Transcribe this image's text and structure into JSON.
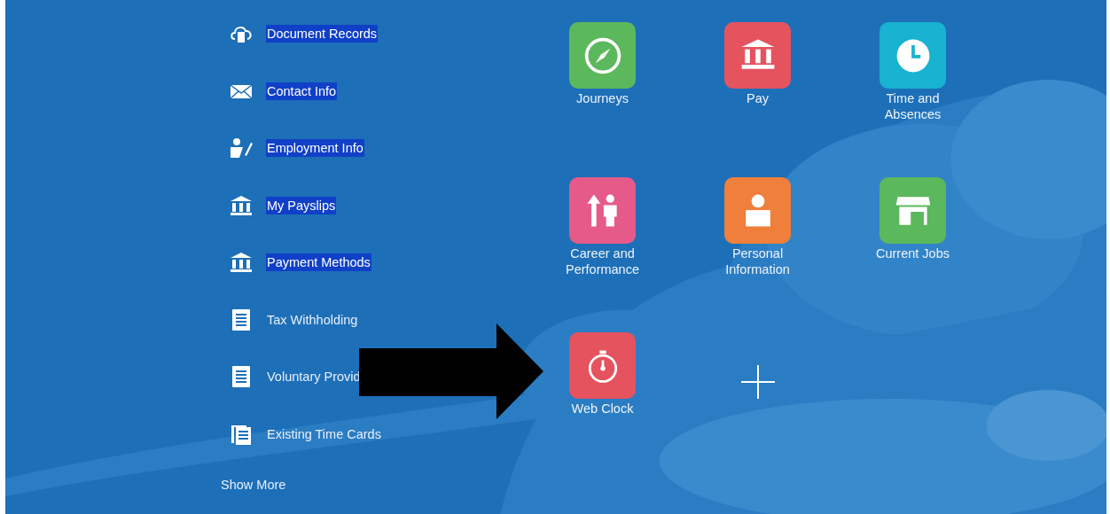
{
  "quick_actions": [
    {
      "label": "Document Records",
      "kind": "cloud-document",
      "highlighted": true
    },
    {
      "label": "Contact Info",
      "kind": "mail",
      "highlighted": true
    },
    {
      "label": "Employment Info",
      "kind": "person-edit",
      "highlighted": true
    },
    {
      "label": "My Payslips",
      "kind": "bank",
      "highlighted": true
    },
    {
      "label": "Payment Methods",
      "kind": "bank",
      "highlighted": true
    },
    {
      "label": "Tax Withholding",
      "kind": "document",
      "highlighted": false
    },
    {
      "label": "Voluntary Provid",
      "kind": "document",
      "highlighted": false
    },
    {
      "label": "Existing Time Cards",
      "kind": "documents",
      "highlighted": false
    }
  ],
  "show_more": "Show More",
  "apps": [
    {
      "label": "Journeys",
      "kind": "compass",
      "color": "#5cb85c"
    },
    {
      "label": "Pay",
      "kind": "bank",
      "color": "#e5535f"
    },
    {
      "label": "Time and Absences",
      "kind": "clock",
      "color": "#17b3d1"
    },
    {
      "label": "Career and Performance",
      "kind": "career",
      "color": "#e65a8a"
    },
    {
      "label": "Personal Information",
      "kind": "person",
      "color": "#ef7f3a"
    },
    {
      "label": "Current Jobs",
      "kind": "store",
      "color": "#5cb85c"
    },
    {
      "label": "Web Clock",
      "kind": "stopwatch",
      "color": "#e5535f"
    },
    {
      "kind": "add"
    }
  ]
}
